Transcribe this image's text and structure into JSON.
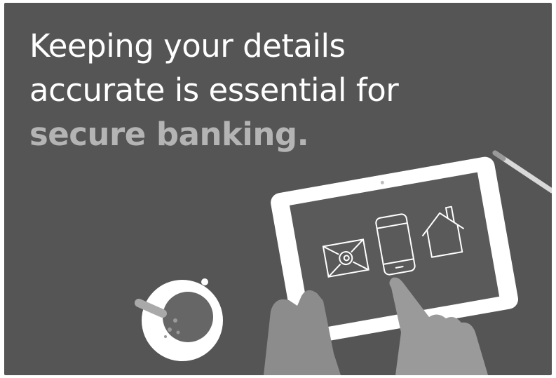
{
  "headline": {
    "line1": "Keeping your details",
    "line2": "accurate is essential for",
    "line3": "secure banking."
  },
  "colors": {
    "background": "#555555",
    "text": "#ffffff",
    "accent": "#b4b4b4",
    "hand": "#8c8c8c",
    "tablet_frame": "#ffffff",
    "tablet_screen": "#5a5a5a"
  },
  "icons": [
    "email-at-icon",
    "mobile-phone-icon",
    "house-icon"
  ]
}
